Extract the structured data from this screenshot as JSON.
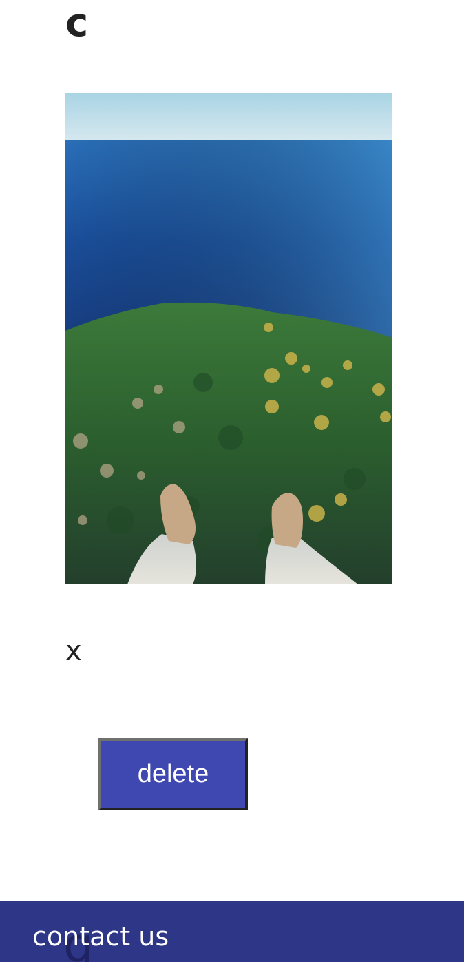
{
  "post": {
    "title": "c",
    "caption": "x",
    "photo_alt": "Aerial view of a forest and sea with legs dangling over the edge"
  },
  "actions": {
    "delete_label": "delete"
  },
  "footer": {
    "link_label": "contact us",
    "background_letter": "g"
  },
  "colors": {
    "button_bg": "#3f48b0",
    "footer_bg": "#2e3687",
    "text": "#222222"
  }
}
